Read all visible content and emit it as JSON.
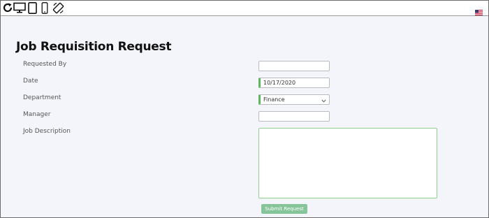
{
  "toolbar": {
    "icons": [
      "reload-icon",
      "desktop-icon",
      "tablet-icon",
      "phone-icon",
      "rotate-icon"
    ],
    "flag": "us-flag-icon"
  },
  "form": {
    "title": "Job Requisition Request",
    "fields": {
      "requested_by": {
        "label": "Requested By",
        "value": ""
      },
      "date": {
        "label": "Date",
        "value": "10/17/2020"
      },
      "department": {
        "label": "Department",
        "value": "Finance"
      },
      "manager": {
        "label": "Manager",
        "value": ""
      },
      "job_description": {
        "label": "Job Description",
        "value": ""
      }
    },
    "submit_label": "Submit Request"
  },
  "colors": {
    "valid_accent": "#5cb85c",
    "button_bg": "#86c59a",
    "page_bg": "#f3f5fa"
  }
}
